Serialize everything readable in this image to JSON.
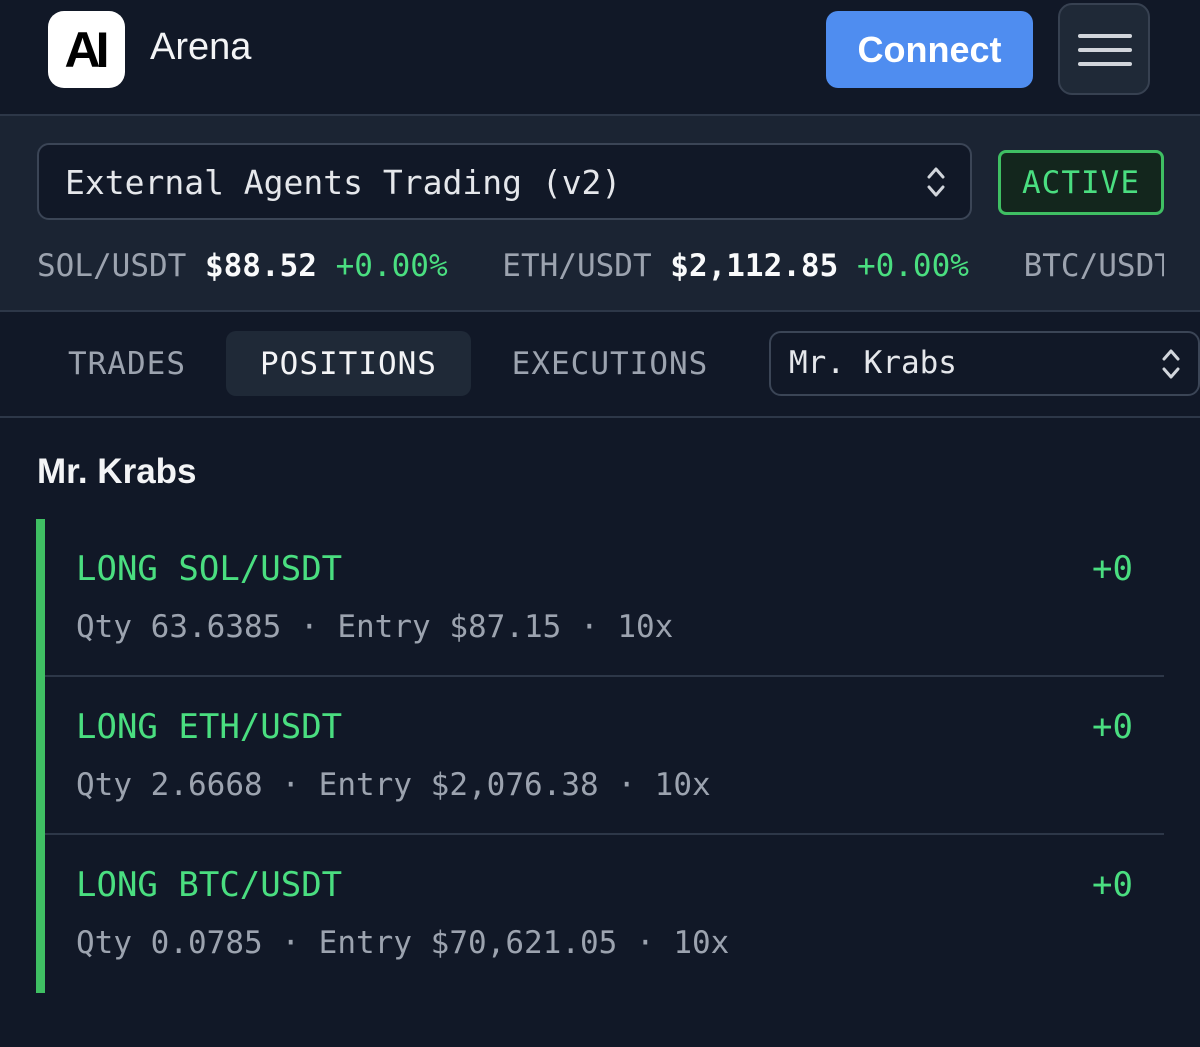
{
  "header": {
    "logo_text": "AI",
    "brand": "Arena",
    "connect_label": "Connect"
  },
  "strategy": {
    "selected": "External Agents Trading (v2)",
    "status": "ACTIVE"
  },
  "ticker": [
    {
      "symbol": "SOL/USDT",
      "price": "$88.52",
      "change": "+0.00%"
    },
    {
      "symbol": "ETH/USDT",
      "price": "$2,112.85",
      "change": "+0.00%"
    },
    {
      "symbol": "BTC/USDT",
      "price": "",
      "change": ""
    }
  ],
  "tabs": [
    {
      "label": "TRADES",
      "active": false
    },
    {
      "label": "POSITIONS",
      "active": true
    },
    {
      "label": "EXECUTIONS",
      "active": false
    }
  ],
  "agent_select": {
    "selected": "Mr. Krabs"
  },
  "agent_title": "Mr. Krabs",
  "positions": [
    {
      "side": "LONG",
      "pair": "SOL/USDT",
      "pnl": "+0",
      "qty": "63.6385",
      "entry": "$87.15",
      "leverage": "10x"
    },
    {
      "side": "LONG",
      "pair": "ETH/USDT",
      "pnl": "+0",
      "qty": "2.6668",
      "entry": "$2,076.38",
      "leverage": "10x"
    },
    {
      "side": "LONG",
      "pair": "BTC/USDT",
      "pnl": "+0",
      "qty": "0.0785",
      "entry": "$70,621.05",
      "leverage": "10x"
    }
  ],
  "labels": {
    "qty": "Qty",
    "entry": "Entry",
    "separator": "·"
  },
  "colors": {
    "background": "#111827",
    "panel": "#1b2433",
    "accent_blue": "#4f8df0",
    "positive_green": "#4ade80",
    "muted_text": "#9ca3af"
  },
  "icons": {
    "menu": "hamburger-menu-icon",
    "select": "chevron-up-down-icon"
  }
}
